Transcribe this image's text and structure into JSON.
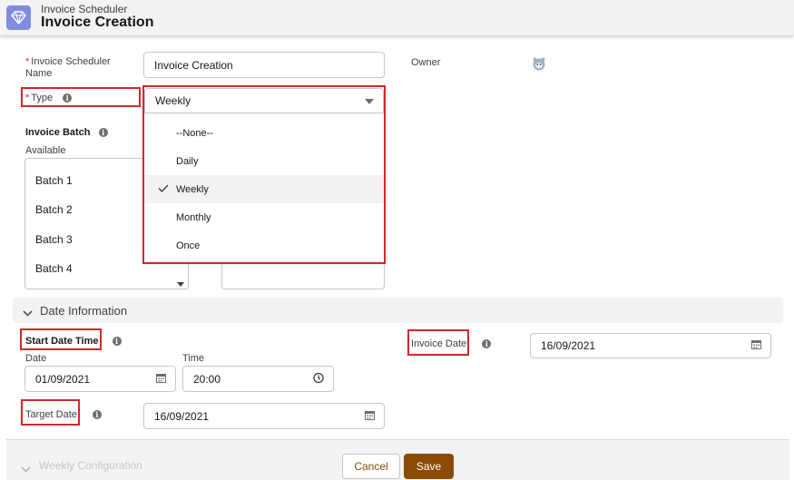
{
  "header": {
    "object_label": "Invoice Scheduler",
    "record_title": "Invoice Creation"
  },
  "form": {
    "name_label_line1": "Invoice Scheduler",
    "name_label_line2": "Name",
    "name_value": "Invoice Creation",
    "owner_label": "Owner",
    "type_label": "Type",
    "type_value": "Weekly",
    "required_marker": "*",
    "invoice_batch_label": "Invoice Batch",
    "available_label": "Available",
    "batches": [
      "Batch 1",
      "Batch 2",
      "Batch 3",
      "Batch 4"
    ]
  },
  "type_dropdown": {
    "options": [
      "--None--",
      "Daily",
      "Weekly",
      "Monthly",
      "Once"
    ],
    "selected_index": 2
  },
  "date_section": {
    "title": "Date Information",
    "start_date_time_label": "Start Date Time",
    "date_label": "Date",
    "date_value": "01/09/2021",
    "time_label": "Time",
    "time_value": "20:00",
    "invoice_date_label": "Invoice Date",
    "invoice_date_value": "16/09/2021",
    "target_date_label": "Target Date",
    "target_date_value": "16/09/2021"
  },
  "weekly_section": {
    "title": "Weekly Configuration"
  },
  "footer": {
    "cancel_label": "Cancel",
    "save_label": "Save"
  },
  "colors": {
    "brand_icon": "#7f8de1",
    "highlight": "#d5262e",
    "save_button": "#8c4b02",
    "required": "#c23934"
  }
}
